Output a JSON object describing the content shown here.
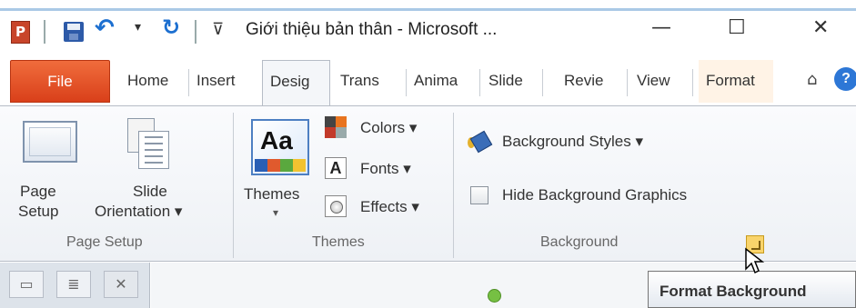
{
  "window": {
    "title": "Giới thiệu bản thân  -  Microsoft ...",
    "minimize_glyph": "—",
    "maximize_glyph": "☐",
    "close_glyph": "✕"
  },
  "quick_access": {
    "app_icon_letter": "P",
    "items": [
      "save-icon",
      "undo-icon",
      "redo-icon",
      "customize-icon"
    ]
  },
  "tabs": {
    "file": "File",
    "home": "Home",
    "insert": "Insert",
    "design": "Desig",
    "transitions": "Trans",
    "animations": "Anima",
    "slideshow": "Slide",
    "review": "Revie",
    "view": "View",
    "format": "Format",
    "active": "Design",
    "help_glyph": "?"
  },
  "ribbon": {
    "page_setup": {
      "page_setup_label": "Page\nSetup",
      "page_setup_line1": "Page",
      "page_setup_line2": "Setup",
      "orientation_line1": "Slide",
      "orientation_line2": "Orientation ▾",
      "group_label": "Page Setup"
    },
    "themes": {
      "themes_line1": "Themes",
      "themes_line2": "▾",
      "colors": "Colors ▾",
      "fonts": "Fonts ▾",
      "effects": "Effects ▾",
      "fonts_icon_letter": "A",
      "themes_icon_text": "Aa",
      "group_label": "Themes"
    },
    "background": {
      "styles": "Background Styles ▾",
      "hide_graphics": "Hide Background Graphics",
      "hide_graphics_checked": false,
      "group_label": "Background"
    }
  },
  "tooltip": {
    "text": "Format Background"
  },
  "colors": {
    "file_tab": "#e04e22",
    "help": "#2d77d6",
    "status_dot": "#76c043"
  }
}
